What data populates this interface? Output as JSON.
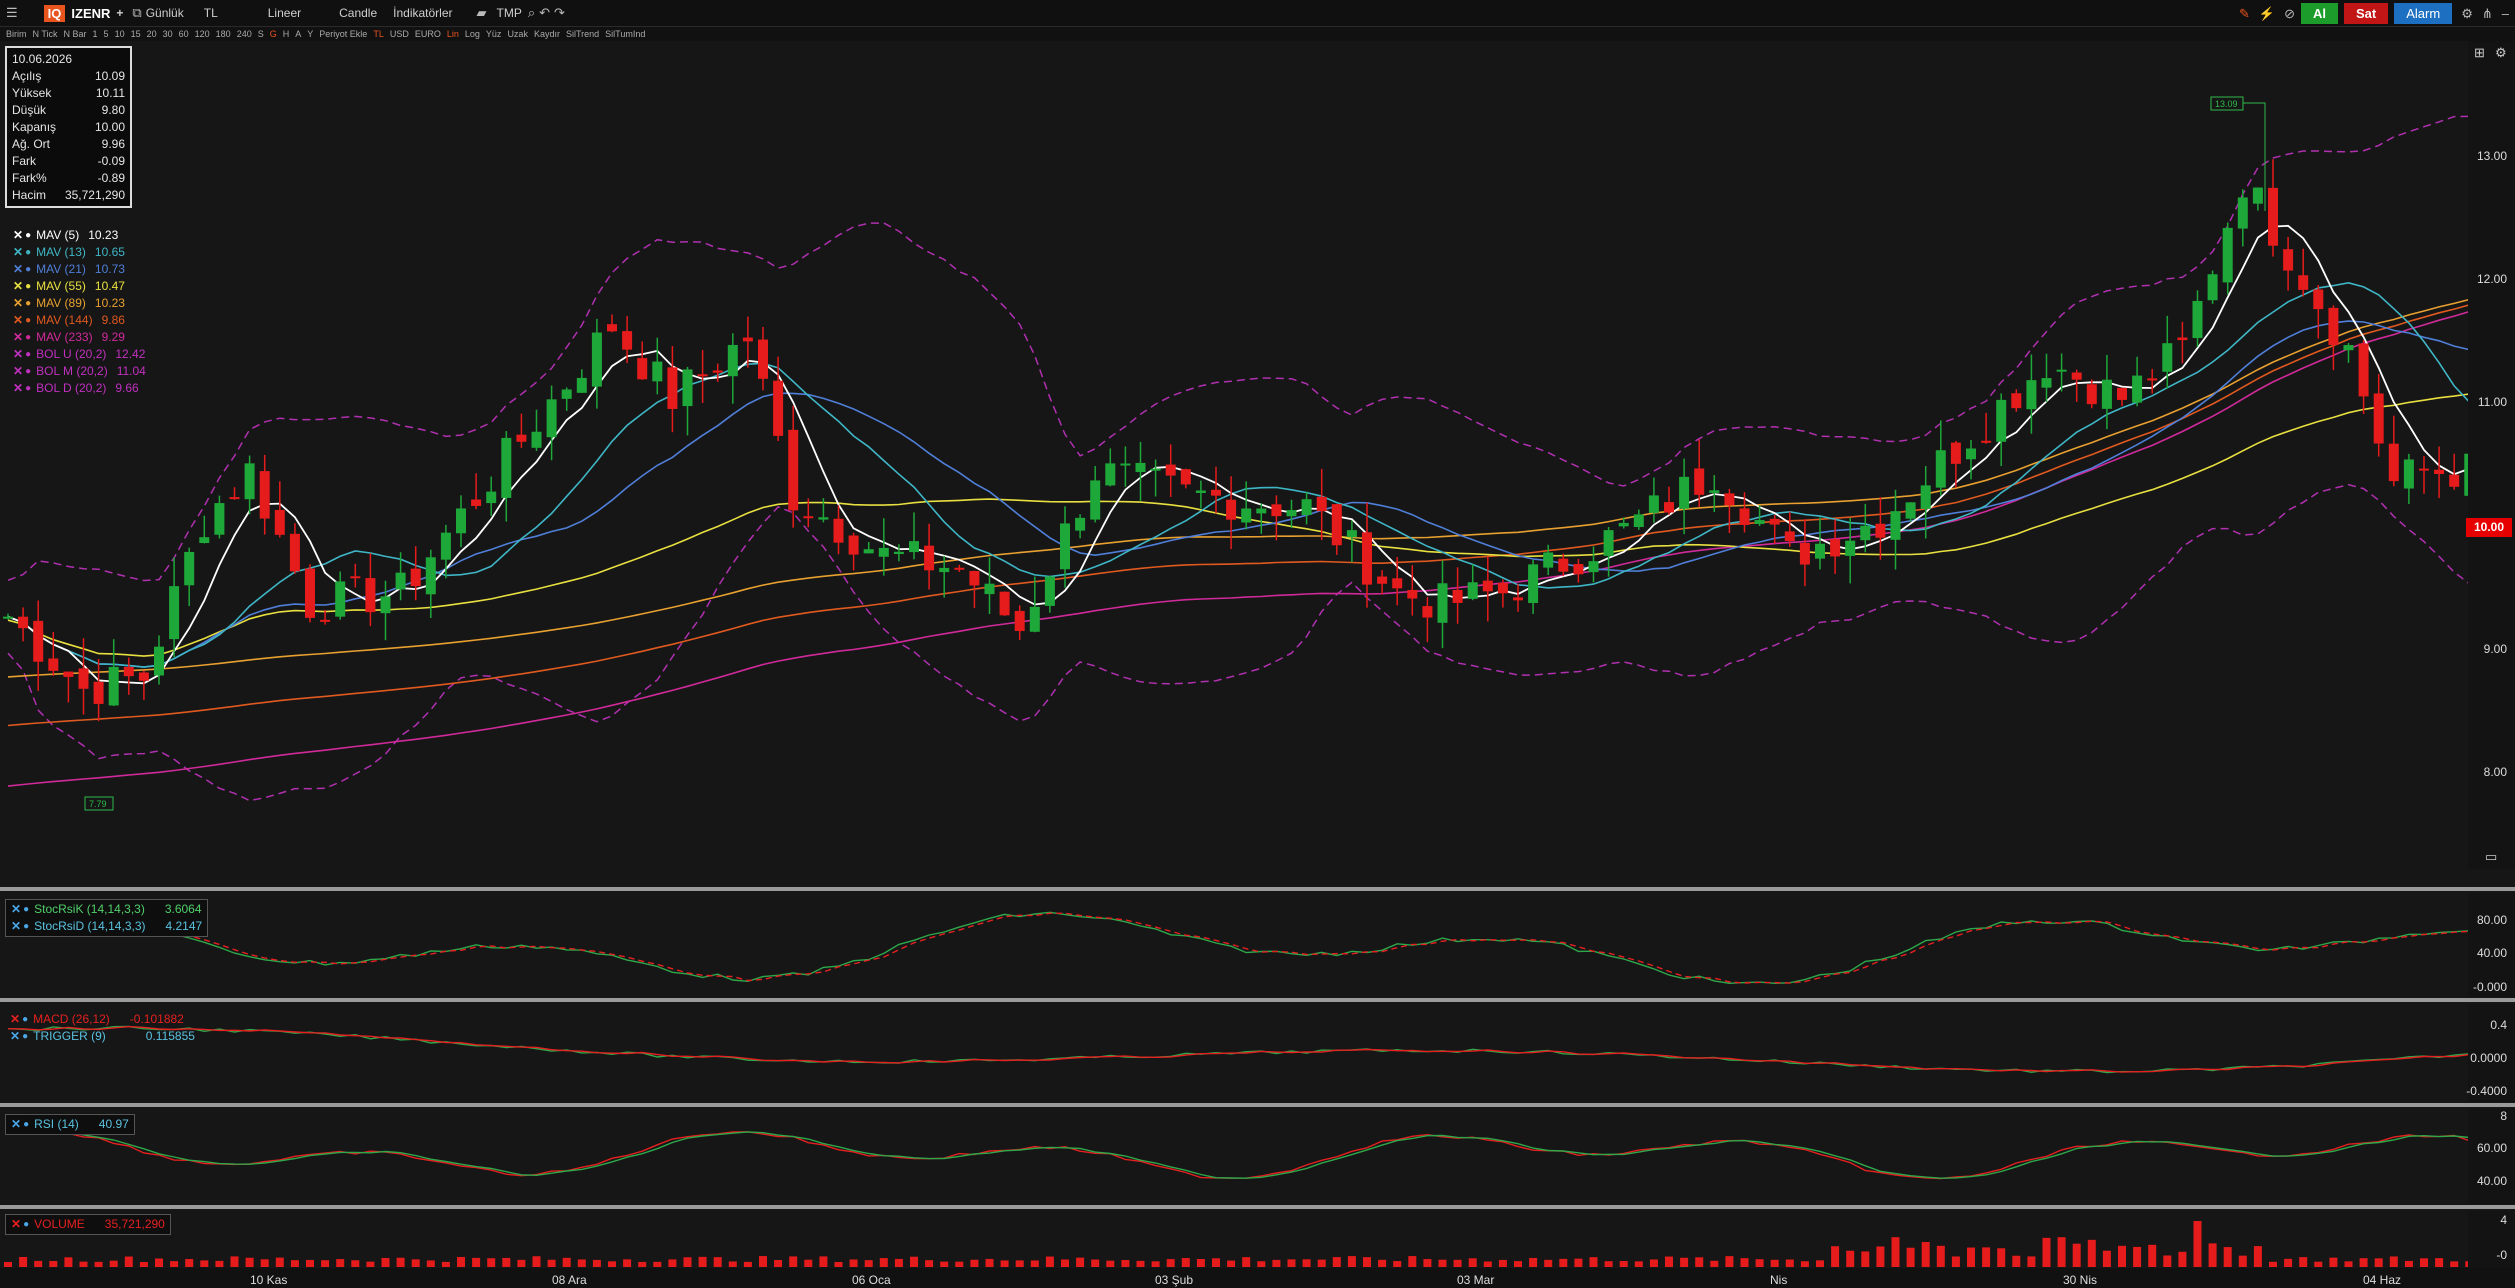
{
  "toolbar": {
    "symbol": "IZENR",
    "plus": "+",
    "period": "Günlük",
    "currency": "TL",
    "scale": "Lineer",
    "chart_type": "Candle",
    "indicators": "İndikatörler",
    "template": "TMP",
    "buy": "Al",
    "sell": "Sat",
    "alarm": "Alarm",
    "logo": "IQ"
  },
  "subbar": [
    "Birim",
    "N Tick",
    "N Bar",
    "1",
    "5",
    "10",
    "15",
    "20",
    "30",
    "60",
    "120",
    "180",
    "240",
    "S",
    "G",
    "H",
    "A",
    "Y",
    "Periyot Ekle",
    "TL",
    "USD",
    "EURO",
    "Lin",
    "Log",
    "Yüz",
    "Uzak",
    "Kaydır",
    "SilTrend",
    "SilTumInd"
  ],
  "info": {
    "date": "10.06.2026",
    "rows": [
      {
        "label": "Açılış",
        "value": "10.09"
      },
      {
        "label": "Yüksek",
        "value": "10.11"
      },
      {
        "label": "Düşük",
        "value": "9.80"
      },
      {
        "label": "Kapanış",
        "value": "10.00"
      },
      {
        "label": "Ağ. Ort",
        "value": "9.96"
      },
      {
        "label": "Fark",
        "value": "-0.09"
      },
      {
        "label": "Fark%",
        "value": "-0.89"
      },
      {
        "label": "Hacim",
        "value": "35,721,290"
      }
    ]
  },
  "legend": [
    {
      "name": "MAV (5)",
      "value": "10.23",
      "color": "#ffffff"
    },
    {
      "name": "MAV (13)",
      "value": "10.65",
      "color": "#3fb6c6"
    },
    {
      "name": "MAV (21)",
      "value": "10.73",
      "color": "#4f7fd8"
    },
    {
      "name": "MAV (55)",
      "value": "10.47",
      "color": "#e8e040"
    },
    {
      "name": "MAV (89)",
      "value": "10.23",
      "color": "#e8a030"
    },
    {
      "name": "MAV (144)",
      "value": "9.86",
      "color": "#e05a20"
    },
    {
      "name": "MAV (233)",
      "value": "9.29",
      "color": "#d02a9a"
    },
    {
      "name": "BOL U (20,2)",
      "value": "12.42",
      "color": "#c030c0"
    },
    {
      "name": "BOL M (20,2)",
      "value": "11.04",
      "color": "#c030c0"
    },
    {
      "name": "BOL D (20,2)",
      "value": "9.66",
      "color": "#c030c0"
    }
  ],
  "price_axis": [
    "13.00",
    "12.00",
    "11.00",
    "9.00",
    "8.00"
  ],
  "last_price": "10.00",
  "annotations": {
    "high": "13.09",
    "low": "7.79"
  },
  "dates": [
    "10 Kas",
    "08 Ara",
    "06 Oca",
    "03 Şub",
    "03 Mar",
    "Nis",
    "30 Nis",
    "04 Haz"
  ],
  "stoch": {
    "k_name": "StocRsiK (14,14,3,3)",
    "k_val": "3.6064",
    "d_name": "StocRsiD (14,14,3,3)",
    "d_val": "4.2147",
    "axis": [
      "80.00",
      "40.00",
      "-0.000"
    ]
  },
  "macd": {
    "name": "MACD (26,12)",
    "val": "-0.101882",
    "trig_name": "TRIGGER (9)",
    "trig_val": "0.115855",
    "axis": [
      "0.4",
      "0.0000",
      "-0.4000"
    ]
  },
  "rsi": {
    "name": "RSI (14)",
    "val": "40.97",
    "axis": [
      "8",
      "60.00",
      "40.00"
    ]
  },
  "volume": {
    "name": "VOLUME",
    "val": "35,721,290",
    "axis": [
      "4",
      "-0"
    ]
  },
  "colors": {
    "up": "#1ea83a",
    "down": "#e61b1b",
    "accent": "#e8541e"
  },
  "chart_data": {
    "type": "line",
    "x": [
      "10 Kas",
      "08 Ara",
      "06 Oca",
      "03 Şub",
      "03 Mar",
      "Nis",
      "30 Nis",
      "04 Haz"
    ],
    "series": [
      {
        "name": "MAV (5)",
        "values": [
          8.9,
          11.0,
          9.3,
          9.5,
          9.3,
          9.6,
          11.7,
          10.23
        ]
      }
    ],
    "ylim": [
      7.5,
      13.5
    ]
  }
}
